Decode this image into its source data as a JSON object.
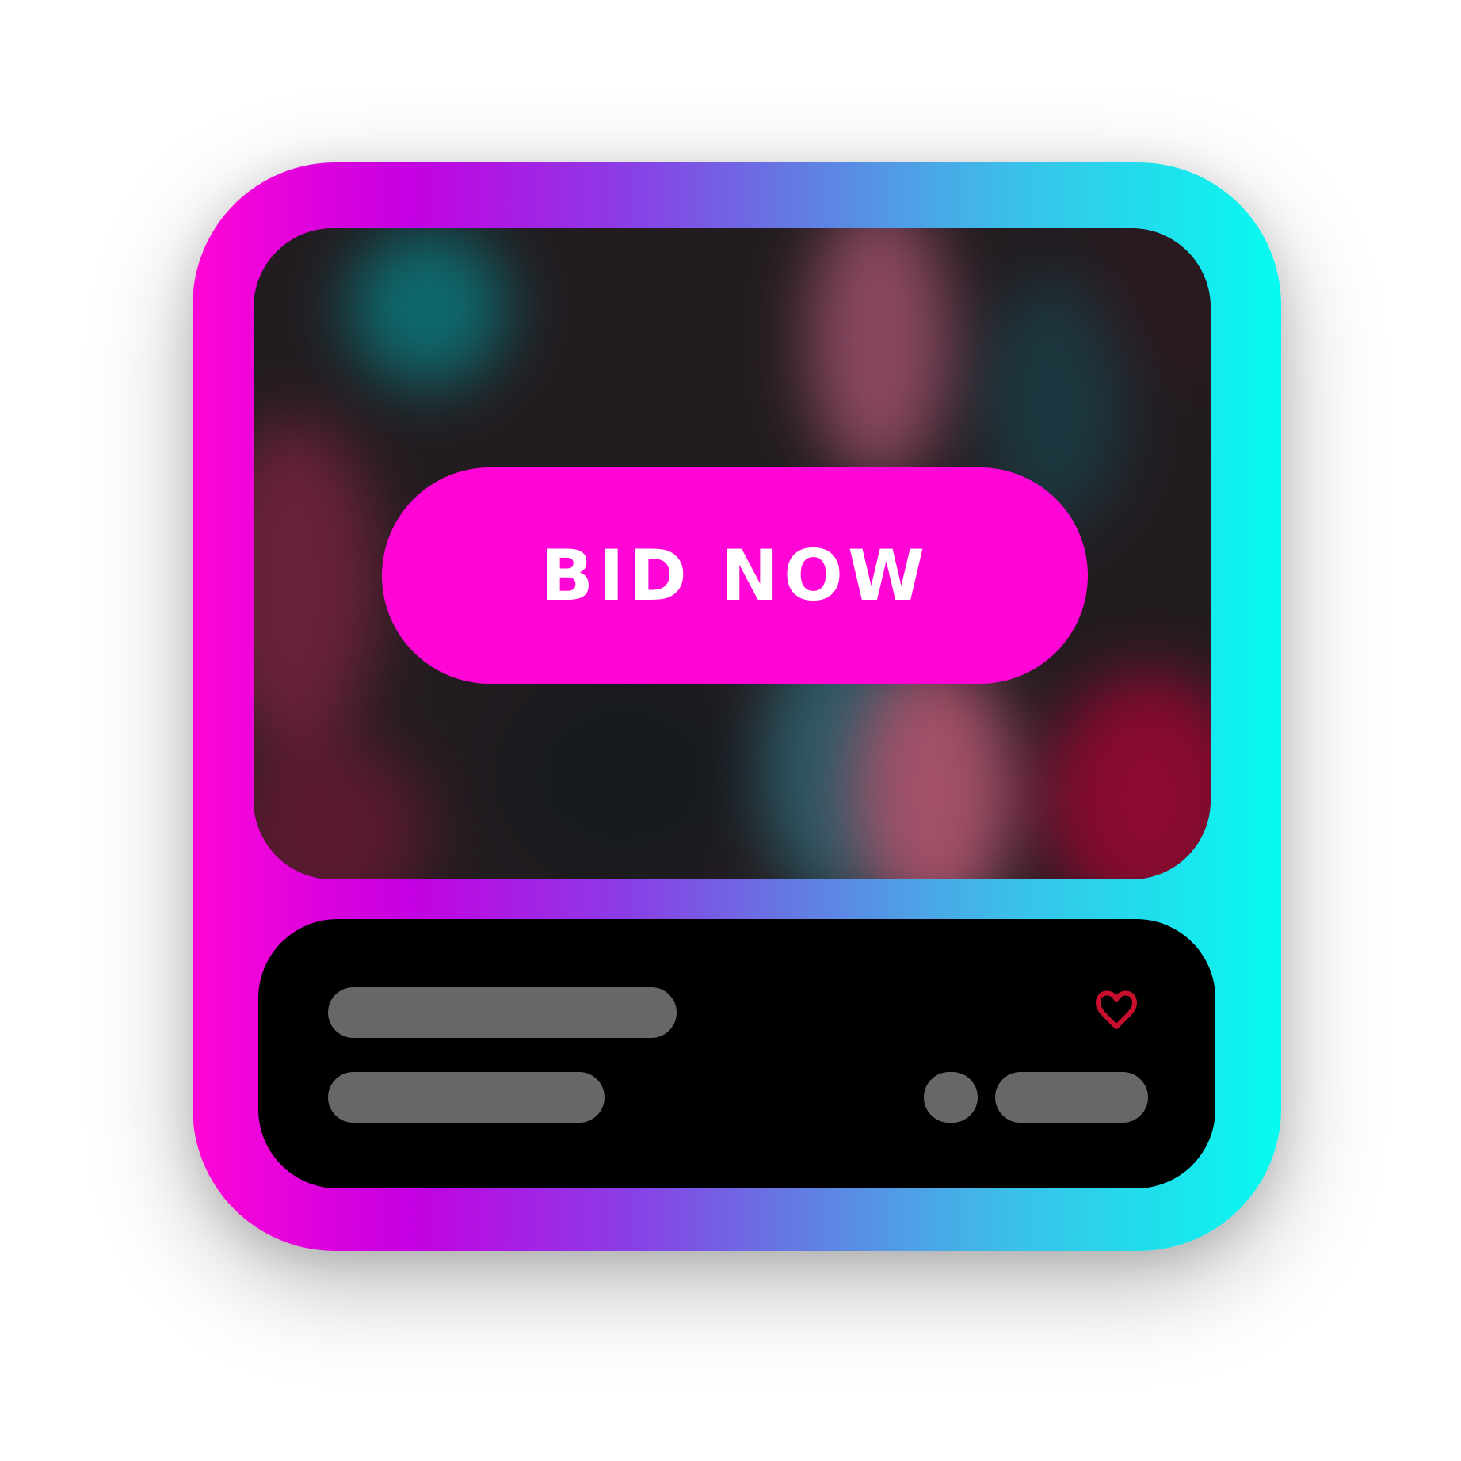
{
  "card": {
    "gradient": [
      "#ff06d6",
      "#c400e2",
      "#8a3ee6",
      "#6479e2",
      "#3cbfe9",
      "#06fbf0"
    ]
  },
  "media": {
    "bid_button_label": "BID NOW",
    "bid_button_color": "#ff06d6"
  },
  "info": {
    "favorite_icon": "heart-outline-icon",
    "favorite_color": "#c8102e",
    "placeholder_color": "#676767"
  }
}
